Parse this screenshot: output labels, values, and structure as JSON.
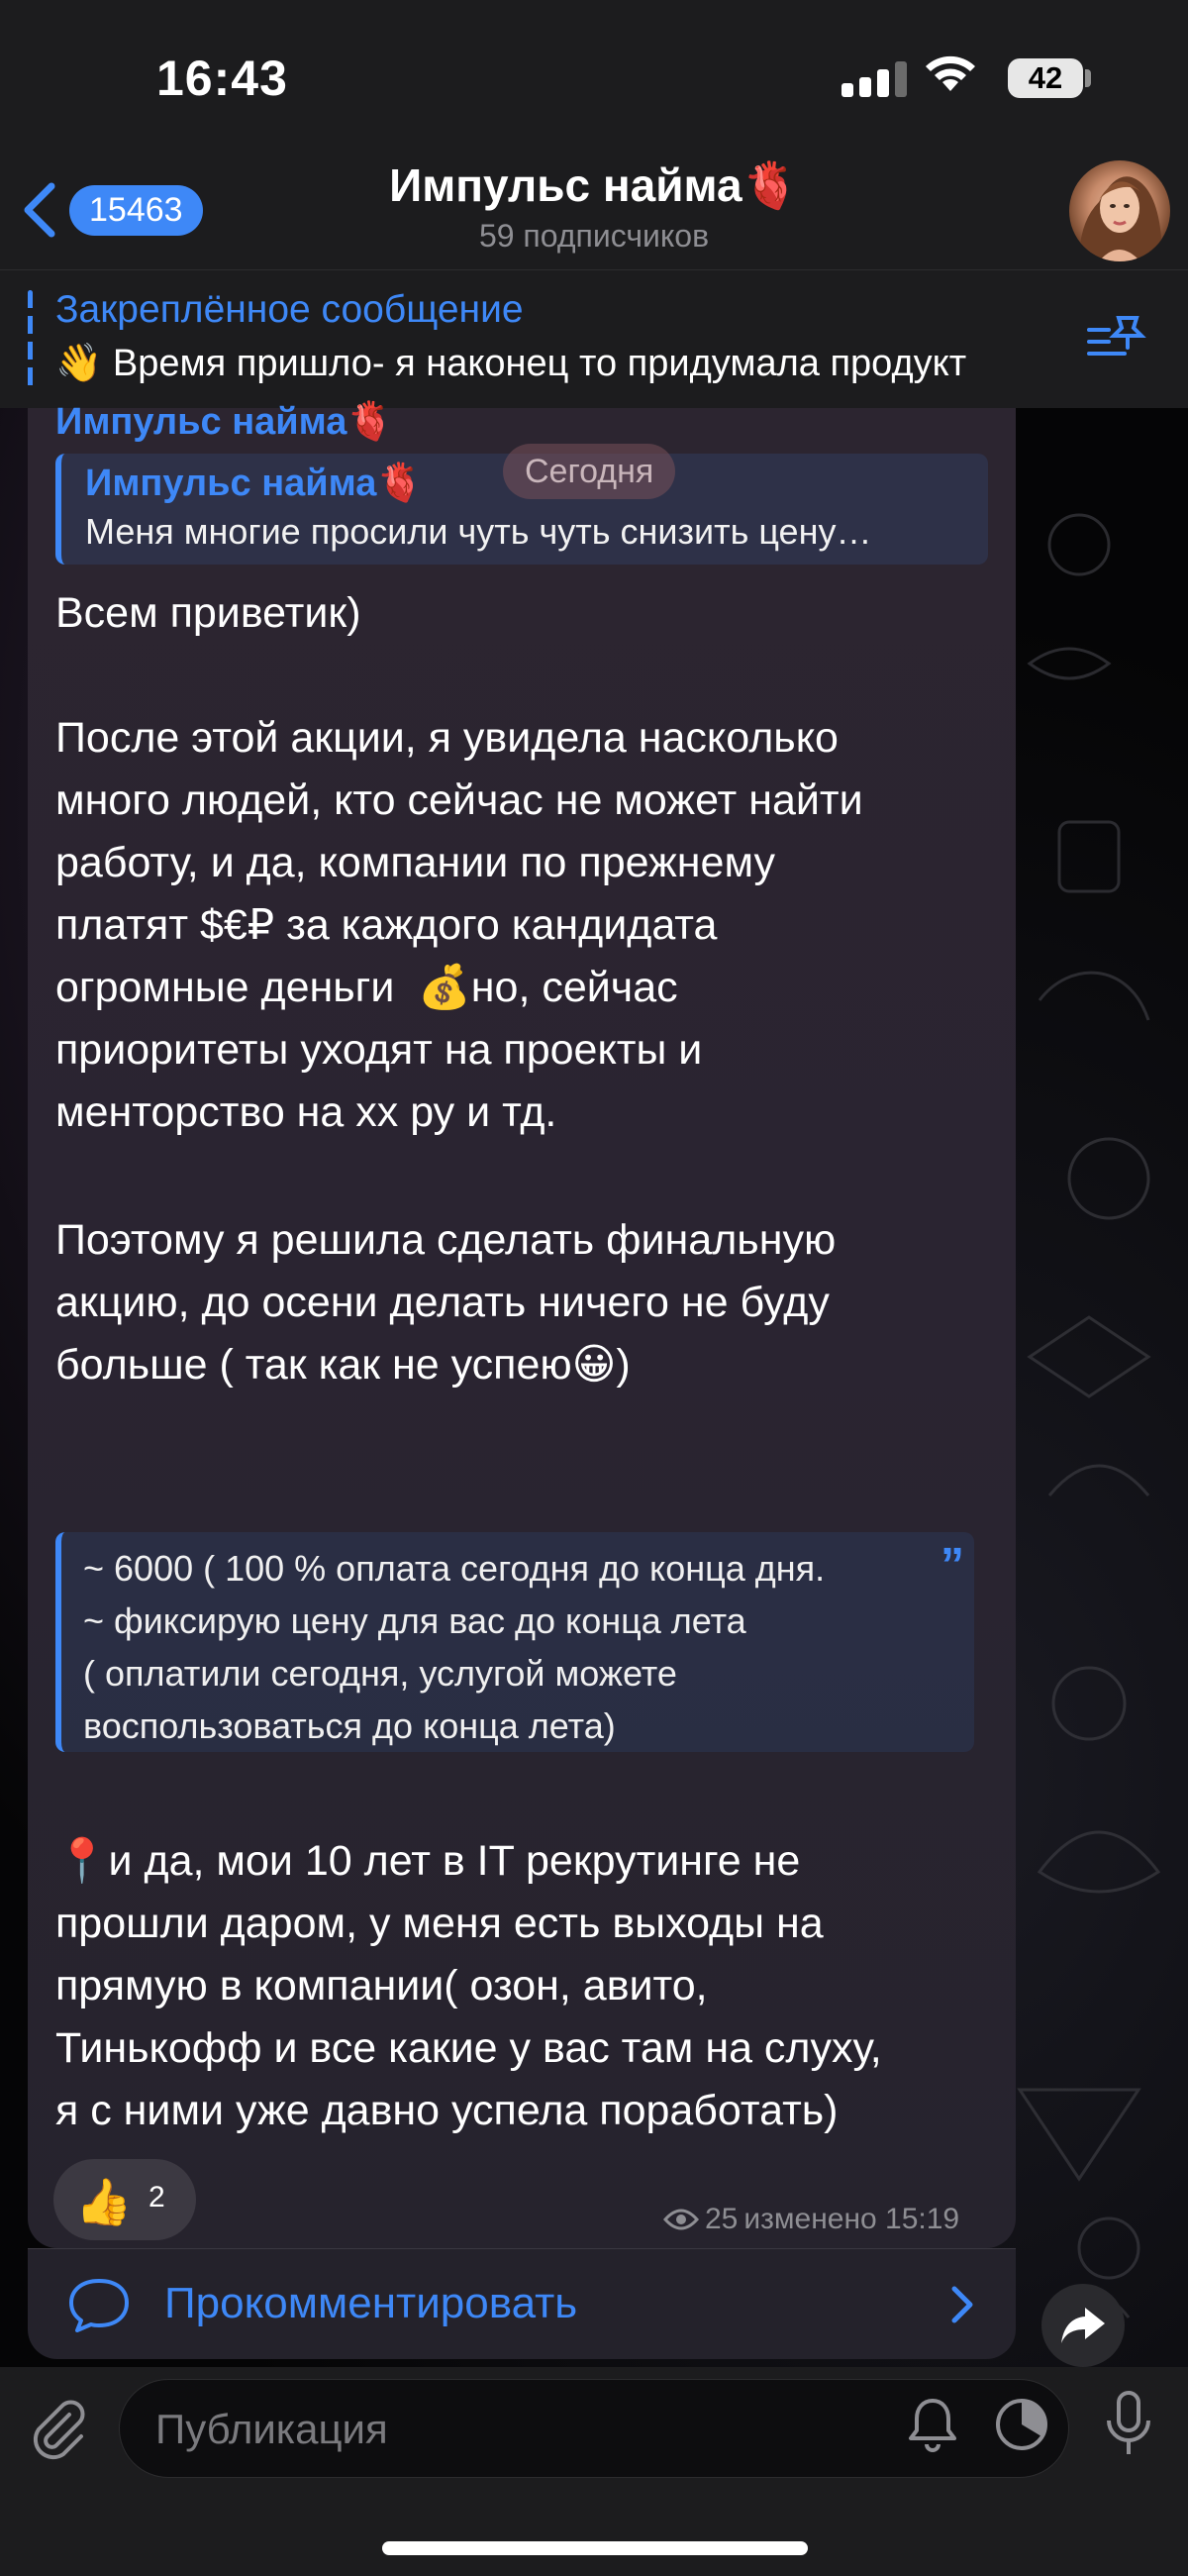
{
  "status": {
    "time": "16:43",
    "battery": "42"
  },
  "header": {
    "back_count": "15463",
    "title": "Импульс найма🫀",
    "subtitle": "59 подписчиков"
  },
  "pinned": {
    "title": "Закреплённое сообщение",
    "text": "👋 Время пришло- я наконец то придумала продукт"
  },
  "message": {
    "sender": "Импульс найма🫀",
    "date_pill": "Сегодня",
    "reply": {
      "name": "Импульс найма🫀",
      "text": "Меня многие просили чуть чуть снизить цену…"
    },
    "greeting": "Всем приветик)",
    "paragraph1": "После этой акции, я увидела насколько\nмного людей, кто сейчас не может найти\nработу, и да, компании по прежнему\nплатят $€₽ за каждого кандидата\nогромные деньги  💰но, сейчас\nприоритеты уходят на проекты и\nменторство на хх ру и тд.",
    "paragraph2": "Поэтому я решила сделать финальную\nакцию, до осени делать ничего не буду\nбольше ( так как не успею😀)",
    "quote": "~ 6000 ( 100 % оплата сегодня до конца дня.\n~ фиксирую цену для вас до конца лета\n( оплатили сегодня, услугой можете\nвоспользоваться до конца лета)",
    "paragraph3": "📍и да, мои 10 лет в IT рекрутинге не\nпрошли даром, у меня есть выходы на\nпрямую в компании( озон, авито,\nТинькофф и все какие у вас там на слуху,\nя с ними уже давно успела поработать)",
    "reaction_emoji": "👍",
    "reaction_count": "2",
    "views": "25",
    "edited": "изменено 15:19",
    "comment_label": "Прокомментировать"
  },
  "input": {
    "placeholder": "Публикация"
  },
  "colors": {
    "accent": "#3e88f7",
    "bar_bg": "#1c1c1e",
    "bubble_bg": "#2a2431"
  }
}
